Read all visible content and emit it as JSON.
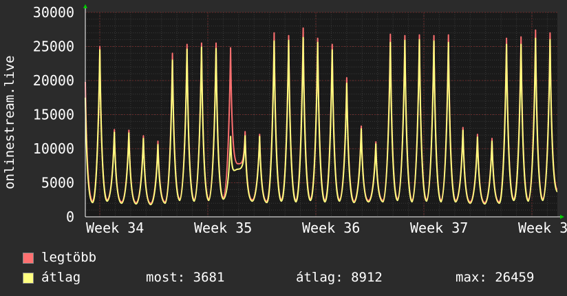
{
  "chart_data": {
    "type": "line",
    "ylabel": "onlinestream.live",
    "ylim": [
      0,
      30000
    ],
    "yticks": [
      "0",
      "5000",
      "10000",
      "15000",
      "20000",
      "25000",
      "30000"
    ],
    "xticks": [
      "Week 34",
      "Week 35",
      "Week 36",
      "Week 37",
      "Week 3"
    ],
    "grid": true,
    "series": [
      {
        "name": "legtöbb",
        "color": "#ff7070",
        "values": [
          19800,
          2300,
          25000,
          2500,
          12800,
          2200,
          12700,
          2100,
          11900,
          2000,
          11100,
          2200,
          24000,
          2600,
          25300,
          2500,
          25500,
          2600,
          25500,
          2800,
          24800,
          7800,
          12500,
          2500,
          12100,
          2300,
          27000,
          2500,
          26600,
          2400,
          27700,
          2600,
          26200,
          2400,
          25300,
          2500,
          20400,
          2300,
          13300,
          2400,
          11000,
          2400,
          26800,
          2600,
          26600,
          2400,
          26700,
          2500,
          26600,
          2400,
          26700,
          2400,
          13100,
          2200,
          12100,
          2100,
          11500,
          2200,
          26200,
          2600,
          26400,
          2500,
          27400,
          2600,
          27000,
          4000
        ]
      },
      {
        "name": "átlag",
        "color": "#ffff80",
        "values": [
          17500,
          2100,
          24500,
          2300,
          12400,
          2000,
          12300,
          1900,
          11500,
          1800,
          10600,
          2000,
          23000,
          2400,
          24600,
          2300,
          24900,
          2400,
          24700,
          2600,
          11800,
          7000,
          11900,
          2300,
          11800,
          2100,
          25800,
          2300,
          25900,
          2200,
          26300,
          2400,
          25600,
          2200,
          24500,
          2300,
          19600,
          2100,
          12900,
          2200,
          10700,
          2200,
          25600,
          2400,
          25900,
          2200,
          26000,
          2300,
          25800,
          2200,
          25600,
          2200,
          12700,
          2000,
          11700,
          1900,
          11100,
          2000,
          25300,
          2400,
          25300,
          2300,
          26200,
          2400,
          26000,
          3700
        ]
      }
    ]
  },
  "legend": {
    "max_label": "legtöbb",
    "avg_label": "átlag",
    "stats": {
      "now": "most: 3681",
      "avg": "átlag: 8912",
      "max": "max: 26459"
    }
  },
  "colors": {
    "background": "#2b2b2b",
    "plot_bg": "#1a1a1a",
    "grid": "#6a2a2a",
    "max_line": "#ff7070",
    "avg_line": "#ffff80",
    "axis_arrow": "#00cc00"
  }
}
